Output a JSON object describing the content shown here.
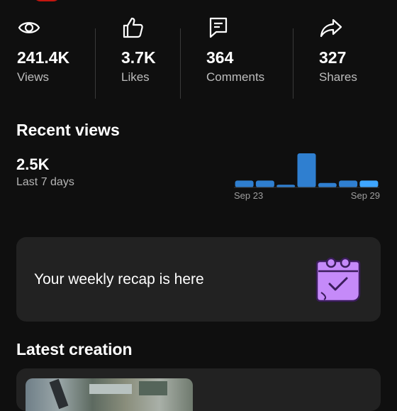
{
  "stats": [
    {
      "value": "241.4K",
      "label": "Views",
      "icon": "eye-icon"
    },
    {
      "value": "3.7K",
      "label": "Likes",
      "icon": "thumbs-up-icon"
    },
    {
      "value": "364",
      "label": "Comments",
      "icon": "comment-icon"
    },
    {
      "value": "327",
      "label": "Shares",
      "icon": "share-icon"
    }
  ],
  "recent_views": {
    "title": "Recent views",
    "value": "2.5K",
    "subtitle": "Last 7 days"
  },
  "chart_data": {
    "type": "bar",
    "categories": [
      "Sep 23",
      "",
      "",
      "",
      "",
      "",
      "Sep 29"
    ],
    "x_tick_labels": [
      "Sep 23",
      "Sep 29"
    ],
    "values": [
      0.2,
      0.2,
      0.08,
      1.0,
      0.13,
      0.2,
      0.2
    ],
    "colors": [
      "#2f7fd0",
      "#2f7fd0",
      "#2f7fd0",
      "#2f7fd0",
      "#2f7fd0",
      "#2f7fd0",
      "#3ea6ff"
    ],
    "title": "",
    "xlabel": "",
    "ylabel": "",
    "grid": false
  },
  "recap": {
    "text": "Your weekly recap is here",
    "icon": "calendar-check-icon"
  },
  "latest": {
    "title": "Latest creation"
  },
  "colors": {
    "background": "#0f0f0f",
    "card": "#222222",
    "accent": "#3ea6ff",
    "recap_icon": "#c58af9"
  }
}
